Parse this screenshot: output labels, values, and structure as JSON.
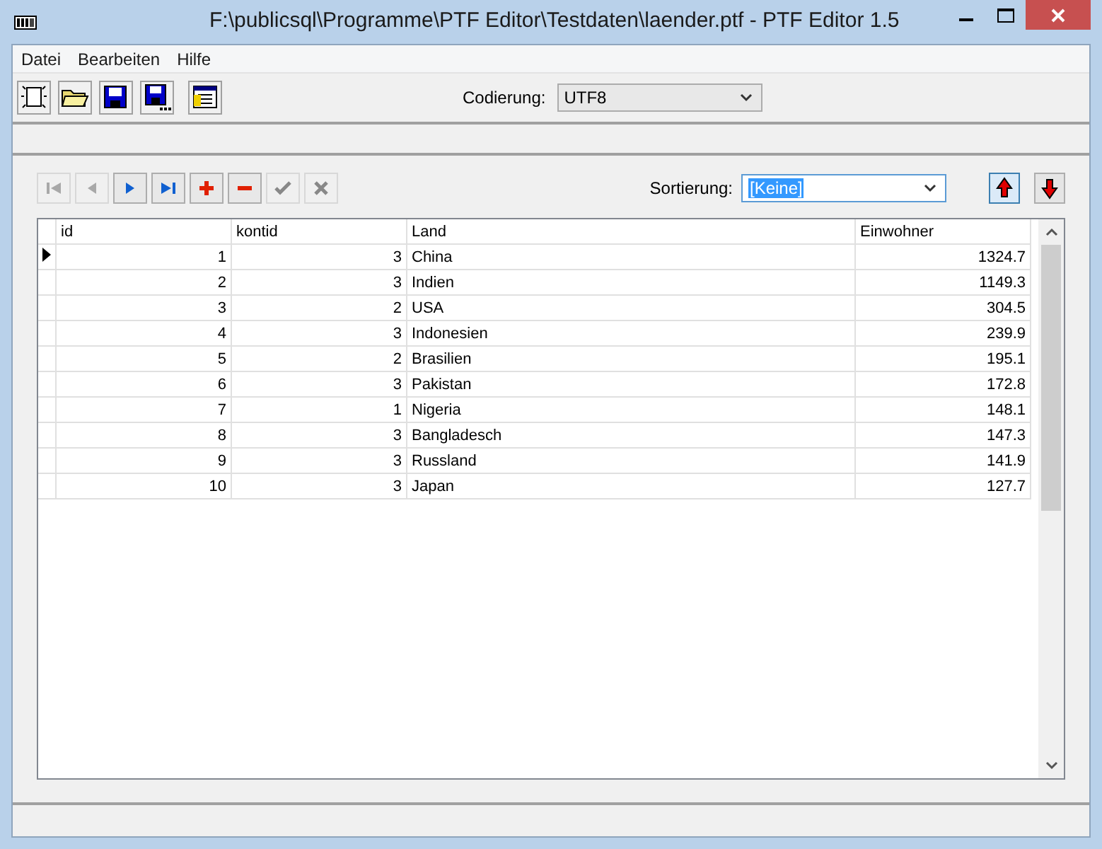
{
  "window": {
    "title": "F:\\publicsql\\Programme\\PTF Editor\\Testdaten\\laender.ptf - PTF Editor 1.5"
  },
  "menu": [
    "Datei",
    "Bearbeiten",
    "Hilfe"
  ],
  "toolbar": {
    "buttons": [
      {
        "kind": "new"
      },
      {
        "kind": "open"
      },
      {
        "kind": "save"
      },
      {
        "kind": "saveas"
      },
      {
        "kind": "props"
      }
    ],
    "encoding_label": "Codierung:",
    "encoding_value": "UTF8"
  },
  "navigator": [
    {
      "kind": "first",
      "disabled": true
    },
    {
      "kind": "prev",
      "disabled": true
    },
    {
      "kind": "next",
      "disabled": false
    },
    {
      "kind": "last",
      "disabled": false
    },
    {
      "kind": "add",
      "disabled": false
    },
    {
      "kind": "delete",
      "disabled": false
    },
    {
      "kind": "post",
      "disabled": true
    },
    {
      "kind": "cancel",
      "disabled": true
    }
  ],
  "sort": {
    "label": "Sortierung:",
    "value": "[Keine]",
    "directions": [
      {
        "kind": "asc",
        "selected": true
      },
      {
        "kind": "desc",
        "selected": false
      }
    ]
  },
  "table": {
    "columns": [
      {
        "label": "id"
      },
      {
        "label": "kontid"
      },
      {
        "label": "Land"
      },
      {
        "label": "Einwohner"
      }
    ],
    "rows": [
      {
        "current": true,
        "cells": [
          "1",
          "3",
          "China",
          "1324.7"
        ]
      },
      {
        "current": false,
        "cells": [
          "2",
          "3",
          "Indien",
          "1149.3"
        ]
      },
      {
        "current": false,
        "cells": [
          "3",
          "2",
          "USA",
          "304.5"
        ]
      },
      {
        "current": false,
        "cells": [
          "4",
          "3",
          "Indonesien",
          "239.9"
        ]
      },
      {
        "current": false,
        "cells": [
          "5",
          "2",
          "Brasilien",
          "195.1"
        ]
      },
      {
        "current": false,
        "cells": [
          "6",
          "3",
          "Pakistan",
          "172.8"
        ]
      },
      {
        "current": false,
        "cells": [
          "7",
          "1",
          "Nigeria",
          "148.1"
        ]
      },
      {
        "current": false,
        "cells": [
          "8",
          "3",
          "Bangladesch",
          "147.3"
        ]
      },
      {
        "current": false,
        "cells": [
          "9",
          "3",
          "Russland",
          "141.9"
        ]
      },
      {
        "current": false,
        "cells": [
          "10",
          "3",
          "Japan",
          "127.7"
        ]
      }
    ]
  }
}
